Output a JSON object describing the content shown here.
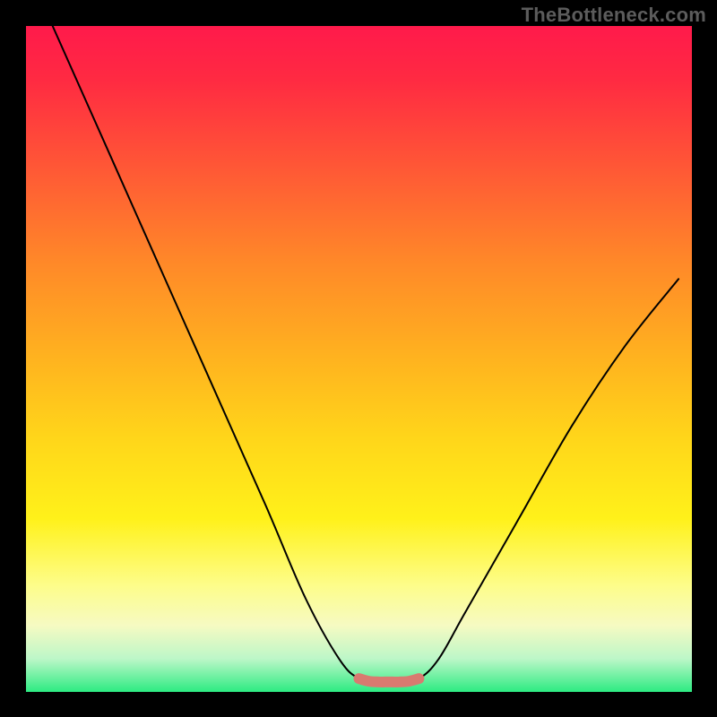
{
  "watermark": "TheBottleneck.com",
  "chart_data": {
    "type": "line",
    "title": "",
    "xlabel": "",
    "ylabel": "",
    "xlim": [
      0,
      100
    ],
    "ylim": [
      0,
      100
    ],
    "grid": false,
    "legend": false,
    "series": [
      {
        "name": "curve",
        "color": "#000000",
        "x": [
          4,
          12,
          20,
          28,
          36,
          42,
          47,
          50,
          53,
          56,
          59,
          62,
          66,
          74,
          82,
          90,
          98
        ],
        "y": [
          100,
          82,
          64,
          46,
          28,
          14,
          5,
          2,
          1.5,
          1.5,
          2,
          5,
          12,
          26,
          40,
          52,
          62
        ]
      },
      {
        "name": "bottom-highlight",
        "color": "#d97a70",
        "x": [
          50,
          51.5,
          53,
          54.5,
          56,
          57.5,
          59
        ],
        "y": [
          2,
          1.6,
          1.5,
          1.5,
          1.5,
          1.6,
          2
        ]
      }
    ],
    "notes": "Axes have no visible tick labels; x and y expressed as 0–100 percent of plot area. y=0 is bottom, y=100 is top."
  }
}
